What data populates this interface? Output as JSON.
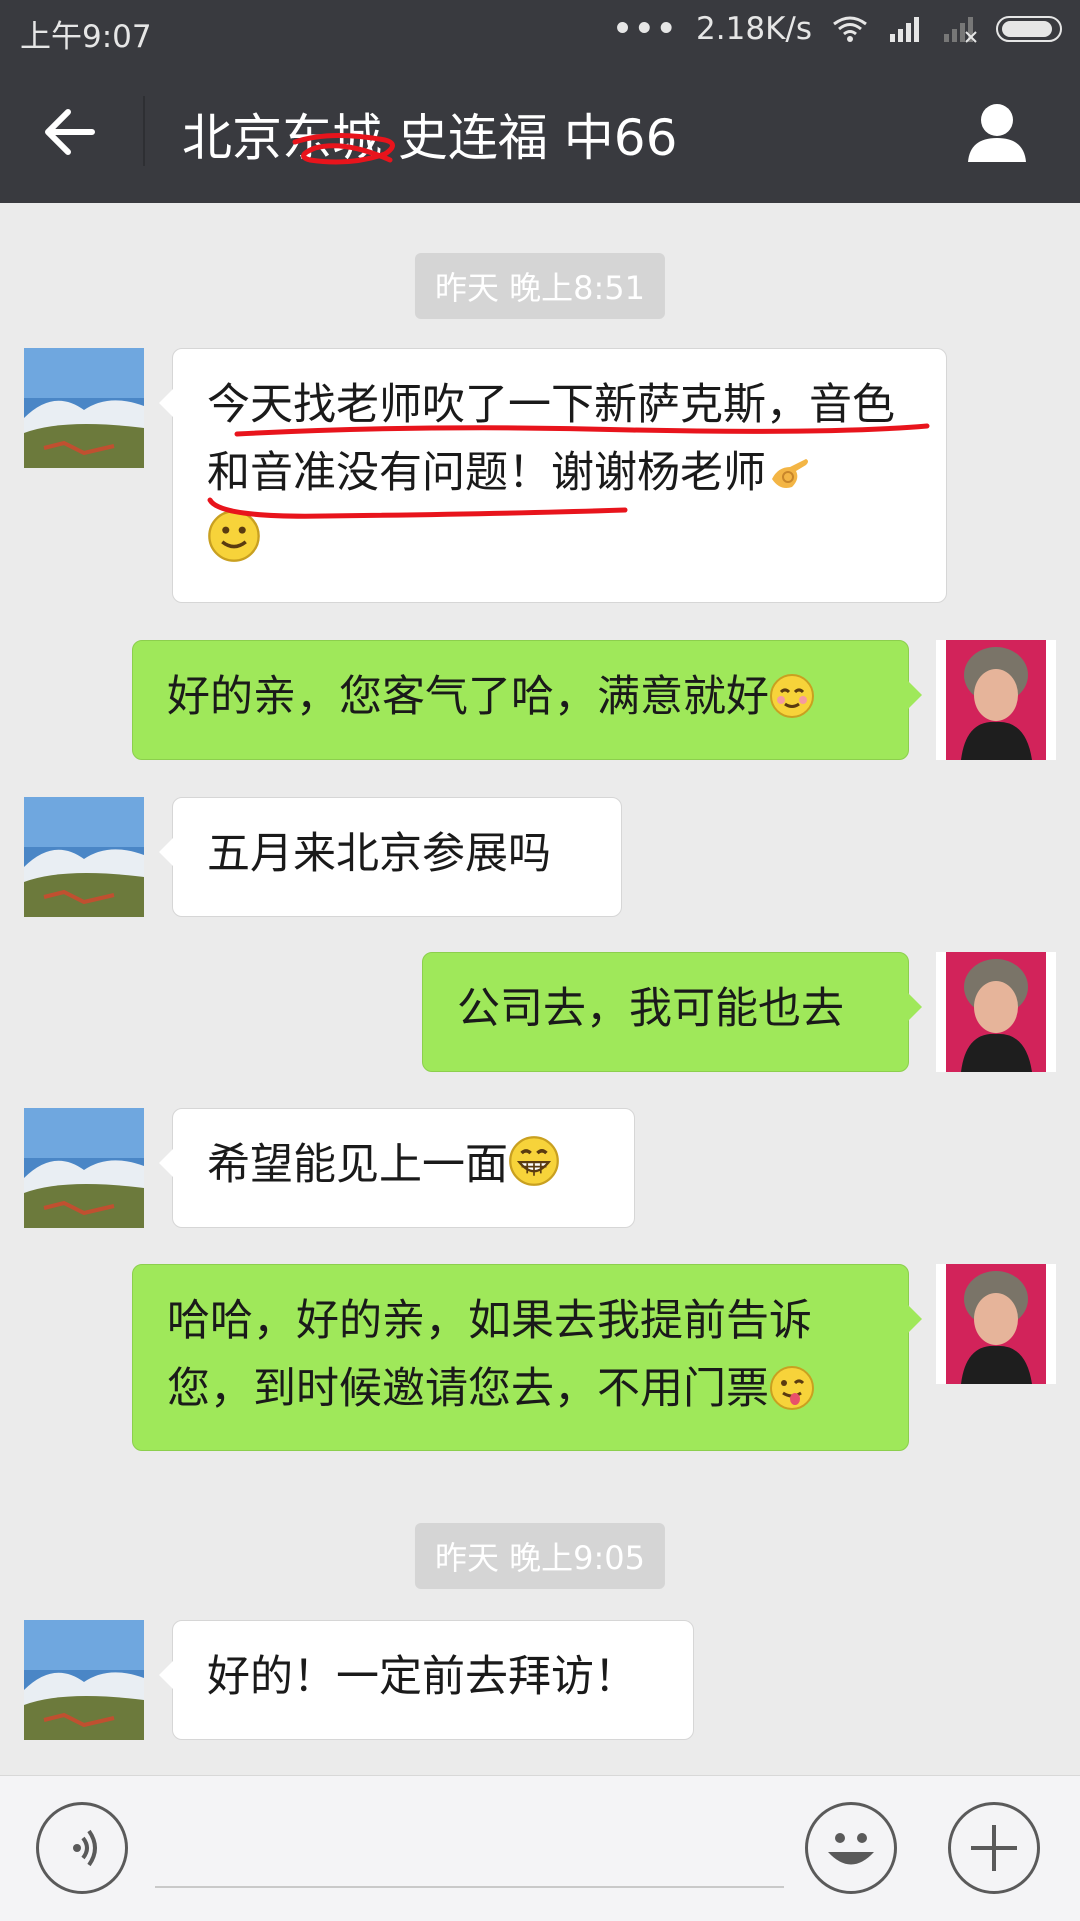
{
  "status_bar": {
    "time": "上午9:07",
    "network_speed": "2.18K/s",
    "dots": "•••",
    "icons": [
      "wifi-icon",
      "signal-icon",
      "no-signal-icon",
      "battery-icon"
    ]
  },
  "header": {
    "title": "北京东城 史连福 中66",
    "icons": [
      "back-arrow-icon",
      "profile-icon"
    ]
  },
  "colors": {
    "header_bg": "#393a3f",
    "chat_bg": "#ebebeb",
    "outgoing_bubble": "#9fe85a",
    "incoming_bubble": "#ffffff",
    "red_markup": "#e8141c"
  },
  "timestamps": [
    "昨天 晚上8:51",
    "昨天 晚上9:05"
  ],
  "messages": [
    {
      "from": "them",
      "text": "今天找老师吹了一下新萨克斯，音色和音准没有问题！谢谢杨老师",
      "emojis": [
        "ok-hand-emoji",
        "smile-emoji"
      ]
    },
    {
      "from": "me",
      "text": "好的亲，您客气了哈，满意就好",
      "emojis": [
        "blush-emoji"
      ]
    },
    {
      "from": "them",
      "text": "五月来北京参展吗"
    },
    {
      "from": "me",
      "text": "公司去，我可能也去"
    },
    {
      "from": "them",
      "text": "希望能见上一面",
      "emojis": [
        "grin-emoji"
      ]
    },
    {
      "from": "me",
      "text": "哈哈，好的亲，如果去我提前告诉您，到时候邀请您去，不用门票",
      "emojis": [
        "wink-tongue-emoji"
      ]
    },
    {
      "from": "them",
      "text": "好的！一定前去拜访！"
    }
  ],
  "input_bar": {
    "icons": [
      "voice-icon",
      "emoji-icon",
      "plus-icon"
    ]
  }
}
